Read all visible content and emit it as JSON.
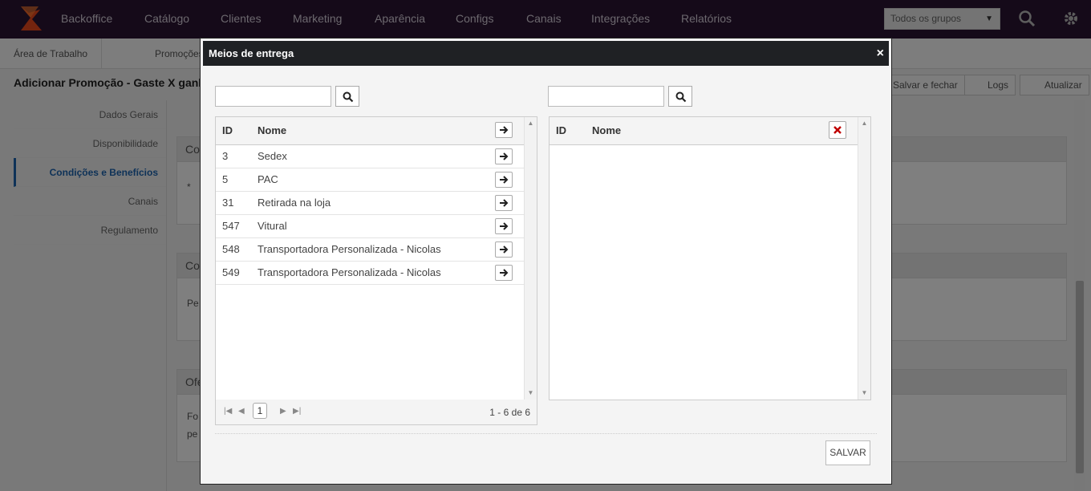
{
  "app": {
    "nav": [
      "Backoffice",
      "Catálogo",
      "Clientes",
      "Marketing",
      "Aparência",
      "Configs",
      "Canais",
      "Integrações",
      "Relatórios"
    ],
    "group_select": "Todos os grupos",
    "subnav": [
      "Área de Trabalho",
      "Promoções"
    ],
    "page_title": "Adicionar Promoção - Gaste X ganhe",
    "toolbar": {
      "save_close": "Salvar e fechar",
      "logs": "Logs",
      "refresh": "Atualizar"
    },
    "side_menu": [
      "Dados Gerais",
      "Disponibilidade",
      "Condições e Benefícios",
      "Canais",
      "Regulamento"
    ],
    "panels": [
      {
        "head": "Co",
        "body": "* "
      },
      {
        "head": "Co",
        "body": "Pe"
      },
      {
        "head": "Ofe",
        "body": "Fo",
        "body2": "pe"
      }
    ]
  },
  "modal": {
    "title": "Meios de entrega",
    "close": "×",
    "left": {
      "search_value": "",
      "headers": {
        "id": "ID",
        "name": "Nome"
      },
      "rows": [
        {
          "id": "3",
          "name": "Sedex"
        },
        {
          "id": "5",
          "name": "PAC"
        },
        {
          "id": "31",
          "name": "Retirada na loja"
        },
        {
          "id": "547",
          "name": "Vitural"
        },
        {
          "id": "548",
          "name": "Transportadora Personalizada - Nicolas"
        },
        {
          "id": "549",
          "name": "Transportadora Personalizada - Nicolas"
        }
      ],
      "pager": {
        "page": "1",
        "info": "1 - 6 de 6"
      }
    },
    "right": {
      "search_value": "",
      "headers": {
        "id": "ID",
        "name": "Nome"
      }
    },
    "save": "SALVAR"
  },
  "colors": {
    "nav_bg": "#2a1433",
    "modal_header": "#1f2124",
    "active": "#1d64b0",
    "remove": "#c00000"
  }
}
